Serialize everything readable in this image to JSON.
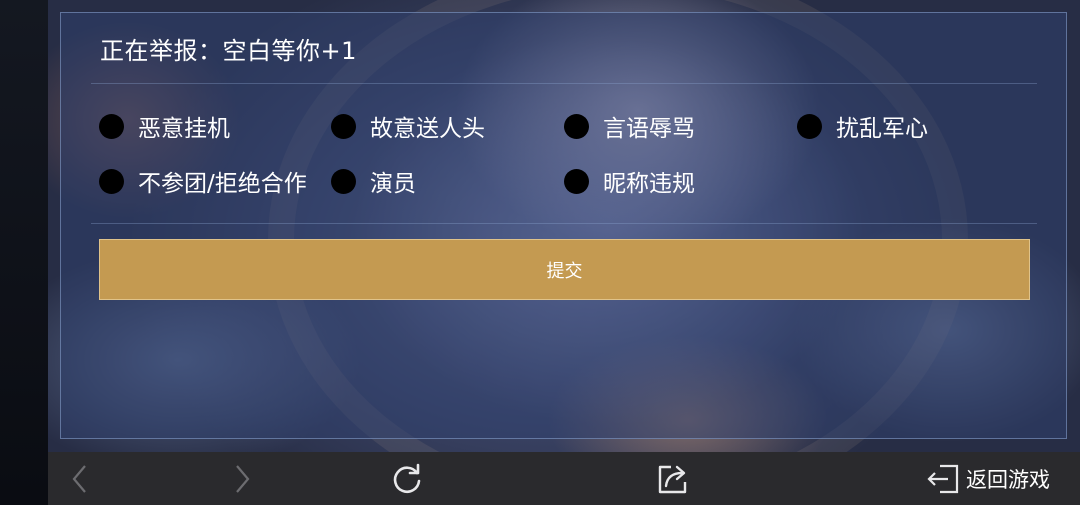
{
  "report": {
    "title": "正在举报：空白等你+1",
    "options": [
      {
        "label": "恶意挂机"
      },
      {
        "label": "故意送人头"
      },
      {
        "label": "言语辱骂"
      },
      {
        "label": "扰乱军心"
      },
      {
        "label": "不参团/拒绝合作"
      },
      {
        "label": "演员"
      },
      {
        "label": "昵称违规"
      }
    ],
    "submit_label": "提交"
  },
  "nav": {
    "back_icon": "chevron-left-icon",
    "forward_icon": "chevron-right-icon",
    "refresh_icon": "refresh-icon",
    "share_icon": "share-icon",
    "exit_icon": "exit-icon",
    "return_game_label": "返回游戏"
  },
  "colors": {
    "accent": "#c49a51",
    "panel_border": "#8ca5d2",
    "bottom_bar": "#2a2a2d"
  }
}
